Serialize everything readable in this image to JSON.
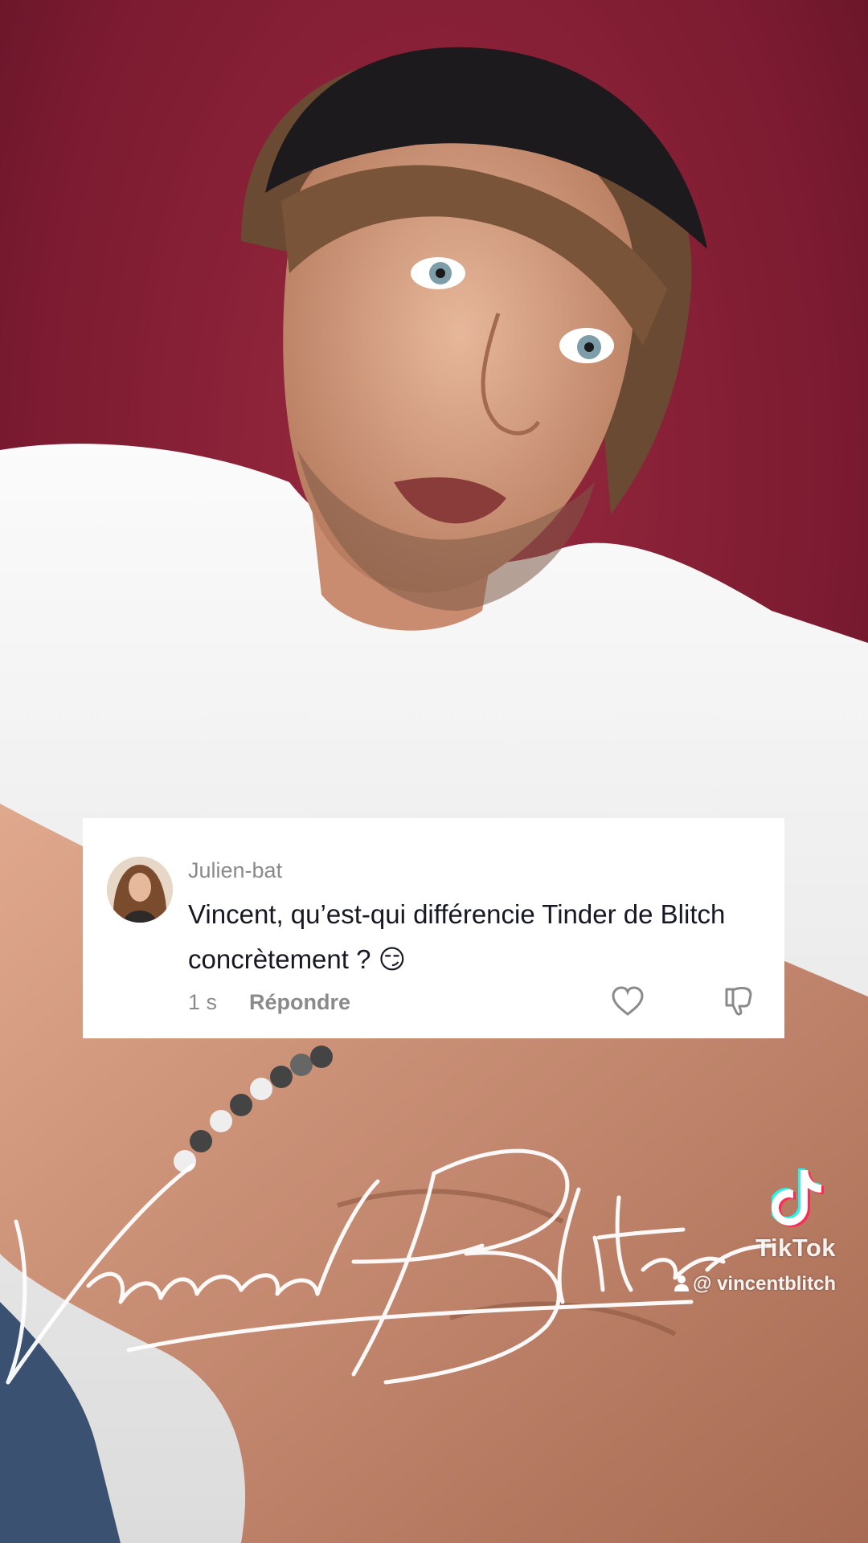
{
  "comment": {
    "username": "Julien-bat",
    "text": "Vincent, qu’est-qui différencie Tinder de Blitch concrètement ? 😏",
    "timestamp": "1 s",
    "reply_label": "Répondre"
  },
  "watermark": {
    "brand": "TikTok",
    "handle": "@ vincentblitch",
    "signature_text": "Vincent Blitch"
  },
  "colors": {
    "card_background": "#ffffff",
    "meta_gray": "#8a8a8a",
    "text_dark": "#161823",
    "tiktok_cyan": "#25f4ee",
    "tiktok_red": "#fe2c55"
  }
}
